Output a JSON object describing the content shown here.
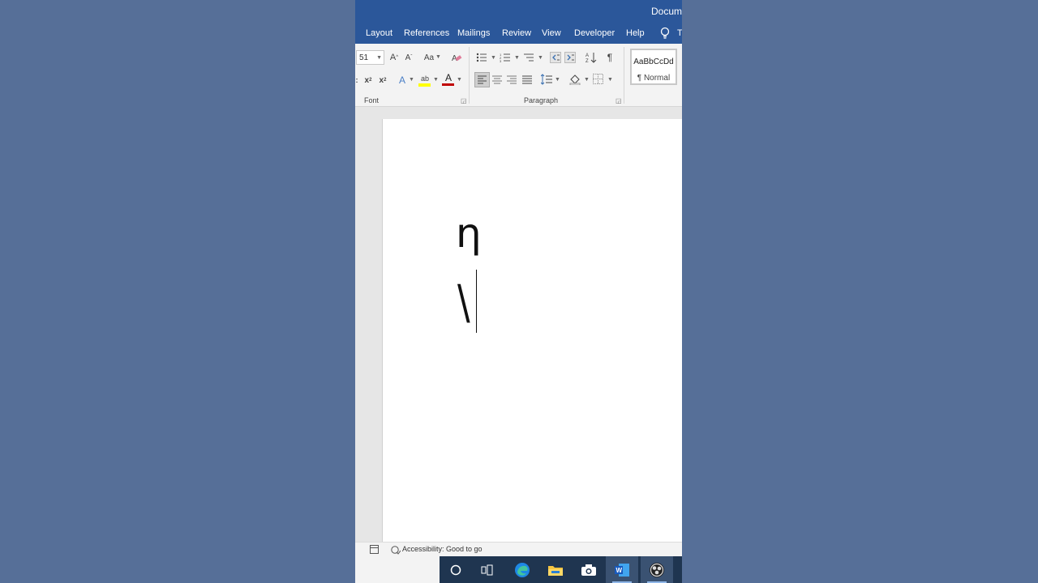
{
  "window": {
    "title": "Docum"
  },
  "tabs": [
    {
      "label": "Layout"
    },
    {
      "label": "References"
    },
    {
      "label": "Mailings"
    },
    {
      "label": "Review"
    },
    {
      "label": "View"
    },
    {
      "label": "Developer"
    },
    {
      "label": "Help"
    }
  ],
  "tell_me": "T",
  "ribbon": {
    "font_size": "51",
    "grow_font": "A",
    "shrink_font": "A",
    "change_case": "Aa",
    "subscript": "x",
    "superscript": "x",
    "text_effects": "A",
    "highlight": "ab",
    "font_color": "A",
    "show_marks": "¶",
    "font_group_label": "Font",
    "paragraph_group_label": "Paragraph",
    "style_sample": "AaBbCcDd",
    "style_name": "¶ Normal"
  },
  "document": {
    "line1": "η",
    "line2": "\\"
  },
  "statusbar": {
    "accessibility": "Accessibility: Good to go"
  },
  "taskbar": {
    "icons": [
      "search-icon",
      "task-view-icon",
      "edge-icon",
      "file-explorer-icon",
      "camera-icon",
      "word-icon",
      "obs-icon"
    ]
  },
  "colors": {
    "background": "#566f98",
    "title_bar": "#2b579a",
    "taskbar": "#1f3550",
    "font_color_underline": "#c00000",
    "highlight": "#ffff00"
  }
}
